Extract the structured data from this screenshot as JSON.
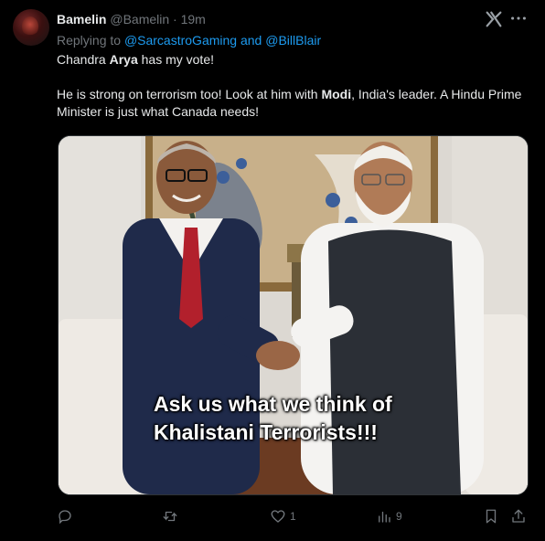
{
  "tweet": {
    "display_name": "Bamelin",
    "handle": "@Bamelin",
    "separator": "·",
    "time": "19m",
    "replying_prefix": "Replying to",
    "replying_to_1": "@SarcastroGaming",
    "replying_and": "and",
    "replying_to_2": "@BillBlair",
    "line1_a": "Chandra ",
    "line1_bold": "Arya",
    "line1_b": " has my vote!",
    "line2_a": "He is strong on terrorism too!  Look at him with ",
    "line2_bold": "Modi",
    "line2_b": ", India's leader.  A Hindu Prime Minister is just what Canada needs!",
    "image_caption_line1": "Ask us what we think of",
    "image_caption_line2": "Khalistani Terrorists!!!"
  },
  "actions": {
    "reply_count": "",
    "retweet_count": "",
    "like_count": "1",
    "views_count": "9"
  },
  "colors": {
    "background": "#000000",
    "text": "#e7e9ea",
    "muted": "#71767b",
    "link": "#1d9bf0"
  },
  "icons": [
    "avatar",
    "grok-x-icon",
    "more-icon",
    "reply-icon",
    "retweet-icon",
    "like-icon",
    "views-icon",
    "bookmark-icon",
    "share-icon"
  ]
}
